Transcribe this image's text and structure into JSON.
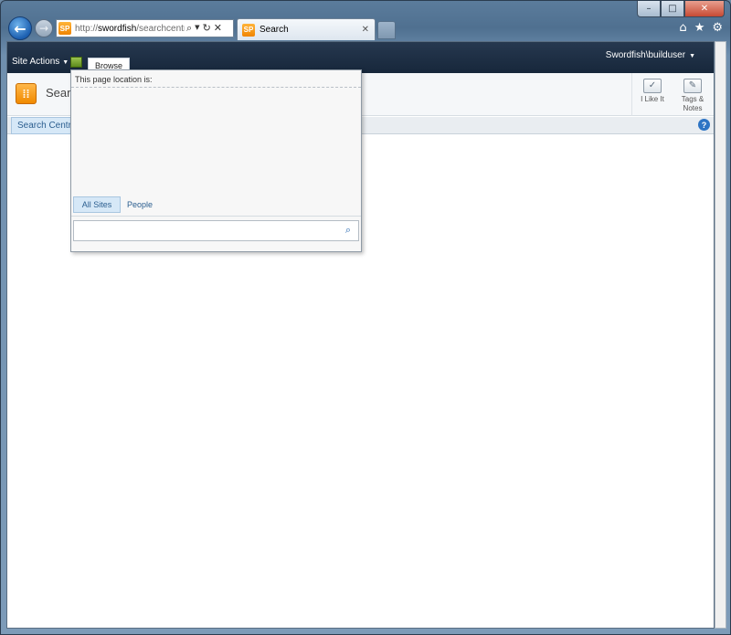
{
  "browser": {
    "url_prefix": "http://",
    "url_host": "swordfish",
    "url_path": "/searchcentre/",
    "tab_title": "Search",
    "tab_favicon": "SP",
    "icons": {
      "back": "back-arrow-icon",
      "forward": "forward-arrow-icon",
      "search": "search-icon",
      "refresh": "refresh-icon",
      "stop": "stop-icon",
      "home": "home-icon",
      "favorites": "star-icon",
      "tools": "gear-icon"
    }
  },
  "window": {
    "minimize": "–",
    "maximize": "□",
    "close": "✕"
  },
  "ribbon": {
    "site_actions": "Site Actions",
    "browse_tab": "Browse",
    "user": "Swordfish\\builduser"
  },
  "header": {
    "site_title": "Searc",
    "i_like_it": "I Like It",
    "tags_notes_line1": "Tags &",
    "tags_notes_line2": "Notes"
  },
  "top_nav": {
    "search_centre": "Search Centre"
  },
  "popup": {
    "location_label": "This page location is:",
    "scope_all_sites": "All Sites",
    "scope_people": "People",
    "search_placeholder": ""
  },
  "colors": {
    "ribbon_bg": "#1e2f45",
    "accent_blue": "#2b5e8f",
    "selected_scope": "#d6e8f7",
    "logo_orange": "#f08a00"
  }
}
